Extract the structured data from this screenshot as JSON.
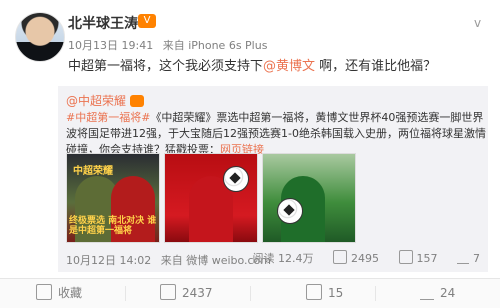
{
  "header": {
    "name": "北半球王涛",
    "badge_text": "V",
    "chevron": "v"
  },
  "meta": {
    "date": "10月13日 19:41",
    "source": "来自 iPhone 6s Plus"
  },
  "post": {
    "text_before": "中超第一福将，这个我必须支持下",
    "mention": "@黄博文",
    "text_after": " 啊，还有谁比他福？"
  },
  "repost": {
    "user": "@中超荣耀",
    "hashtag": "#中超第一福将#",
    "body": "《中超荣耀》票选中超第一福将，黄博文世界杯40强预选赛一脚世界波将国足带进12强，于大宝随后12强预选赛1-0绝杀韩国载入史册，两位福将球星激情碰撞，你会支持谁？猛戳投票：",
    "link": "网页链接",
    "images": {
      "img1_title": "中超荣耀",
      "img1_caption": "终极票选 南北对决 谁是中超第一福将"
    },
    "meta": {
      "date": "10月12日 14:02",
      "source": "来自 微博 weibo.com"
    },
    "actions": {
      "reads": "阅读 12.4万",
      "reposts": "2495",
      "comments": "157",
      "likes": "7"
    }
  },
  "bottom": {
    "collect": "收藏",
    "repost": "2437",
    "comment": "15",
    "like": "24"
  },
  "colors": {
    "accent": "#eb7350",
    "badge": "#ff8200",
    "gray": "#808080"
  }
}
